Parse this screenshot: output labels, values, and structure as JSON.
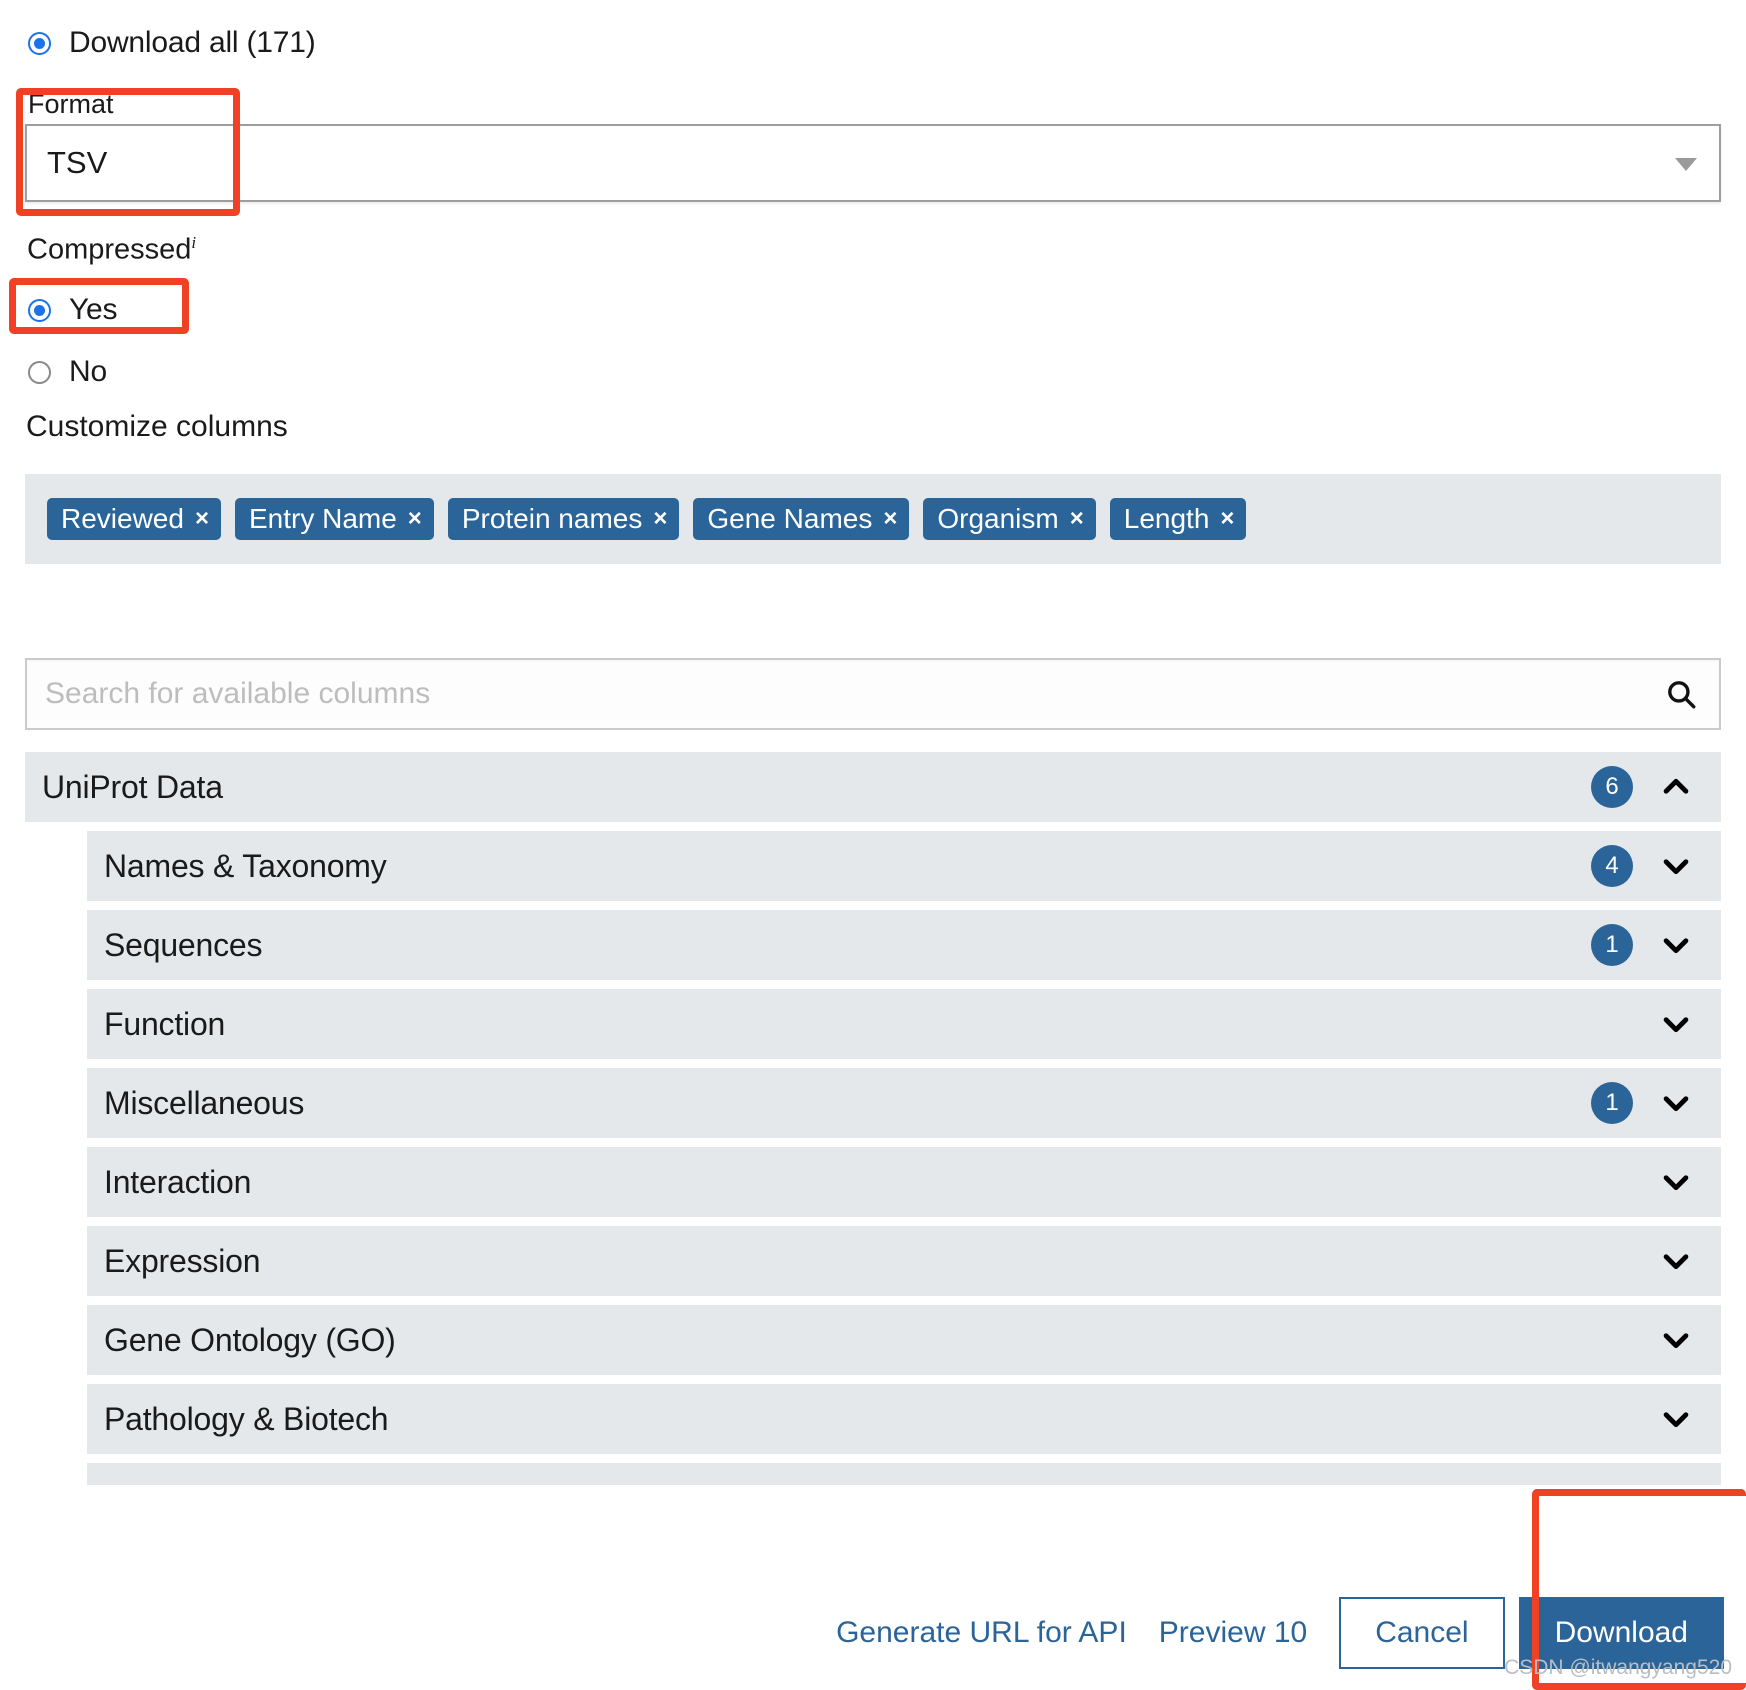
{
  "download_all": {
    "label": "Download all (171)",
    "selected": true,
    "count": 171
  },
  "format": {
    "label": "Format",
    "value": "TSV",
    "caret_icon": "chevron-down-icon"
  },
  "compressed": {
    "label": "Compressed",
    "info_marker": "i",
    "options": [
      {
        "label": "Yes",
        "selected": true
      },
      {
        "label": "No",
        "selected": false
      }
    ]
  },
  "customize_columns": {
    "label": "Customize columns",
    "selected_chips": [
      {
        "label": "Reviewed",
        "remove_icon": "×"
      },
      {
        "label": "Entry Name",
        "remove_icon": "×"
      },
      {
        "label": "Protein names",
        "remove_icon": "×"
      },
      {
        "label": "Gene Names",
        "remove_icon": "×"
      },
      {
        "label": "Organism",
        "remove_icon": "×"
      },
      {
        "label": "Length",
        "remove_icon": "×"
      }
    ],
    "search": {
      "placeholder": "Search for available columns",
      "value": "",
      "icon": "search-icon"
    },
    "groups": [
      {
        "label": "UniProt Data",
        "badge": "6",
        "expanded": true,
        "level": 0
      },
      {
        "label": "Names & Taxonomy",
        "badge": "4",
        "expanded": false,
        "level": 1
      },
      {
        "label": "Sequences",
        "badge": "1",
        "expanded": false,
        "level": 1
      },
      {
        "label": "Function",
        "badge": "",
        "expanded": false,
        "level": 1
      },
      {
        "label": "Miscellaneous",
        "badge": "1",
        "expanded": false,
        "level": 1
      },
      {
        "label": "Interaction",
        "badge": "",
        "expanded": false,
        "level": 1
      },
      {
        "label": "Expression",
        "badge": "",
        "expanded": false,
        "level": 1
      },
      {
        "label": "Gene Ontology (GO)",
        "badge": "",
        "expanded": false,
        "level": 1
      },
      {
        "label": "Pathology & Biotech",
        "badge": "",
        "expanded": false,
        "level": 1
      }
    ]
  },
  "footer": {
    "generate_url_label": "Generate URL for API",
    "preview_label": "Preview 10",
    "cancel_label": "Cancel",
    "download_label": "Download"
  },
  "watermark": "CSDN @itwangyang520",
  "colors": {
    "accent_blue": "#2b6499",
    "radio_blue": "#1a73e8",
    "row_grey": "#e4e8eb",
    "annotation_red": "#f04124"
  }
}
